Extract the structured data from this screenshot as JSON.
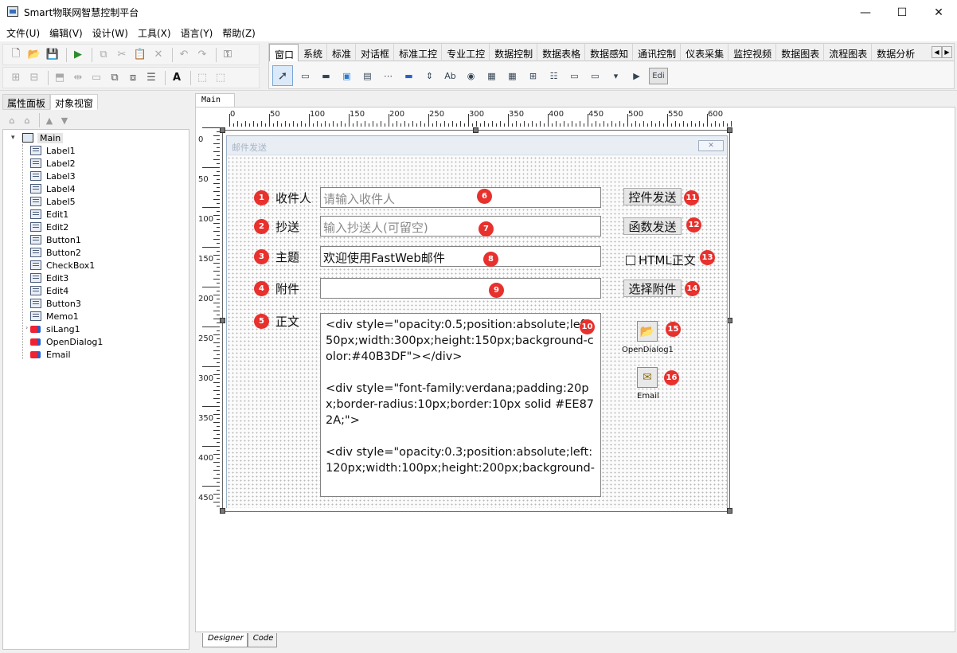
{
  "window": {
    "title": "Smart物联网智慧控制平台",
    "min_label": "—",
    "max_label": "☐",
    "close_label": "✕"
  },
  "menu": [
    "文件(U)",
    "编辑(V)",
    "设计(W)",
    "工具(X)",
    "语言(Y)",
    "帮助(Z)"
  ],
  "palette": {
    "tabs": [
      "窗口",
      "系统",
      "标准",
      "对话框",
      "标准工控",
      "专业工控",
      "数据控制",
      "数据表格",
      "数据感知",
      "通讯控制",
      "仪表采集",
      "监控视频",
      "数据图表",
      "流程图表",
      "数据分析"
    ],
    "active_tab": "窗口",
    "edit_comp_label": "Edi"
  },
  "left_panel": {
    "tabs": [
      "属性面板",
      "对象视窗"
    ],
    "active_tab": "对象视窗",
    "tree_root": "Main",
    "tree_items": [
      {
        "label": "Label1",
        "type": "control"
      },
      {
        "label": "Label2",
        "type": "control"
      },
      {
        "label": "Label3",
        "type": "control"
      },
      {
        "label": "Label4",
        "type": "control"
      },
      {
        "label": "Label5",
        "type": "control"
      },
      {
        "label": "Edit1",
        "type": "control"
      },
      {
        "label": "Edit2",
        "type": "control"
      },
      {
        "label": "Button1",
        "type": "control"
      },
      {
        "label": "Button2",
        "type": "control"
      },
      {
        "label": "CheckBox1",
        "type": "control"
      },
      {
        "label": "Edit3",
        "type": "control"
      },
      {
        "label": "Edit4",
        "type": "control"
      },
      {
        "label": "Button3",
        "type": "control"
      },
      {
        "label": "Memo1",
        "type": "control"
      },
      {
        "label": "siLang1",
        "type": "nonvisual",
        "expandable": true
      },
      {
        "label": "OpenDialog1",
        "type": "nonvisual"
      },
      {
        "label": "Email",
        "type": "nonvisual"
      }
    ]
  },
  "designer": {
    "doc_tab": "Main",
    "ruler_h": [
      "0",
      "50",
      "100",
      "150",
      "200",
      "250",
      "300",
      "350",
      "400",
      "450",
      "500",
      "550",
      "600"
    ],
    "ruler_v": [
      "0",
      "50",
      "100",
      "150",
      "200",
      "250",
      "300",
      "350",
      "400",
      "450"
    ],
    "bottom_tabs": [
      "Designer",
      "Code"
    ]
  },
  "form": {
    "title": "邮件发送",
    "labels": {
      "to": "收件人",
      "cc": "抄送",
      "subject": "主题",
      "attachment": "附件",
      "body": "正文"
    },
    "edits": {
      "to_placeholder": "请输入收件人",
      "cc_placeholder": "输入抄送人(可留空)",
      "subject_value": "欢迎使用FastWeb邮件",
      "attachment_value": ""
    },
    "memo_text": "<div style=\"opacity:0.5;position:absolute;left:50px;width:300px;height:150px;background-color:#40B3DF\"></div>\n\n<div style=\"font-family:verdana;padding:20px;border-radius:10px;border:10px solid #EE872A;\">\n\n<div style=\"opacity:0.3;position:absolute;left:120px;width:100px;height:200px;background-",
    "buttons": {
      "control_send": "控件发送",
      "function_send": "函数发送",
      "choose_attachment": "选择附件"
    },
    "checkbox_label": "HTML正文",
    "nonvisual": {
      "open_dialog": "OpenDialog1",
      "email": "Email"
    },
    "badges": [
      "1",
      "2",
      "3",
      "4",
      "5",
      "6",
      "7",
      "8",
      "9",
      "10",
      "11",
      "12",
      "13",
      "14",
      "15",
      "16"
    ]
  },
  "colors": {
    "badge": "#e8302c",
    "form_title_bg": "#e9eef5",
    "accent": "#2a8c2a"
  }
}
